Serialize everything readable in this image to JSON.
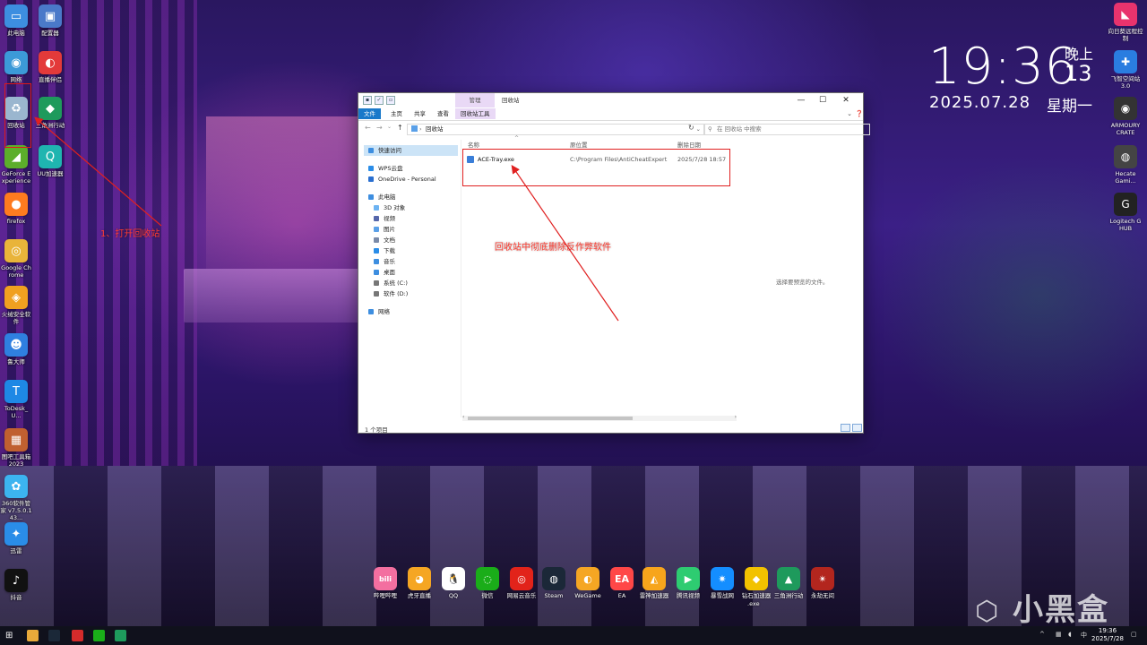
{
  "desktop_left_icons": [
    {
      "label": "此电脑",
      "color": "#3d8ee0",
      "glyph": "▭"
    },
    {
      "label": "配置器",
      "color": "#4a79c9",
      "glyph": "▣"
    },
    {
      "label": "网络",
      "color": "#3c9ad8",
      "glyph": "◉"
    },
    {
      "label": "直播伴侣",
      "color": "#e33a3a",
      "glyph": "◐"
    },
    {
      "label": "回收站",
      "color": "#9ab6cf",
      "glyph": "♻"
    },
    {
      "label": "三角洲行动",
      "color": "#1e9a5c",
      "glyph": "◆"
    },
    {
      "label": "GeForce Experience",
      "color": "#5cae2b",
      "glyph": "◢"
    },
    {
      "label": "UU加速器",
      "color": "#1fb5b0",
      "glyph": "Q"
    },
    {
      "label": "firefox",
      "color": "#ff7b1f",
      "glyph": "●"
    },
    {
      "label": "Google Chrome",
      "color": "#e9b43a",
      "glyph": "◎"
    },
    {
      "label": "火绒安全软件",
      "color": "#f0a020",
      "glyph": "◈"
    },
    {
      "label": "鲁大师",
      "color": "#2f7fe0",
      "glyph": "☻"
    },
    {
      "label": "ToDesk_U...",
      "color": "#1e88e5",
      "glyph": "T"
    },
    {
      "label": "图吧工具箱 2023",
      "color": "#c06030",
      "glyph": "▦"
    },
    {
      "label": "360软件管家 v7.5.0.143...",
      "color": "#3cb4f0",
      "glyph": "✿"
    },
    {
      "label": "迅雷",
      "color": "#2a8de8",
      "glyph": "✦"
    },
    {
      "label": "抖音",
      "color": "#111111",
      "glyph": "♪"
    }
  ],
  "annotations": {
    "step1": "1、打开回收站",
    "step2": "回收站中彻底删除反作弊软件"
  },
  "clock": {
    "time": "19:36",
    "period": "晚上",
    "day": "13",
    "date": "2025.07.28",
    "weekday": "星期一"
  },
  "explorer": {
    "context_tab": "管理",
    "title": "回收站",
    "ribbon_tabs": [
      "文件",
      "主页",
      "共享",
      "查看",
      "回收站工具"
    ],
    "address": "回收站",
    "search_placeholder": "在 回收站 中搜索",
    "nav": [
      {
        "label": "快速访问",
        "level": 0,
        "color": "#3d8ee0"
      },
      {
        "label": "WPS云盘",
        "level": 0,
        "color": "#2a8de8"
      },
      {
        "label": "OneDrive - Personal",
        "level": 0,
        "color": "#2a6fd0"
      },
      {
        "label": "此电脑",
        "level": 0,
        "color": "#3d8ee0"
      },
      {
        "label": "3D 对象",
        "level": 1,
        "color": "#6db3f2"
      },
      {
        "label": "视频",
        "level": 1,
        "color": "#5566aa"
      },
      {
        "label": "图片",
        "level": 1,
        "color": "#5aa0e8"
      },
      {
        "label": "文档",
        "level": 1,
        "color": "#7a8aa8"
      },
      {
        "label": "下载",
        "level": 1,
        "color": "#2a8de8"
      },
      {
        "label": "音乐",
        "level": 1,
        "color": "#3d8ee0"
      },
      {
        "label": "桌面",
        "level": 1,
        "color": "#3d8ee0"
      },
      {
        "label": "系统 (C:)",
        "level": 1,
        "color": "#777777"
      },
      {
        "label": "软件 (D:)",
        "level": 1,
        "color": "#777777"
      },
      {
        "label": "网络",
        "level": 0,
        "color": "#3d8ee0"
      }
    ],
    "columns": {
      "name": "名称",
      "location": "原位置",
      "date": "删除日期"
    },
    "file": {
      "name": "ACE-Tray.exe",
      "location": "C:\\Program Files\\AntiCheatExpert",
      "date": "2025/7/28 18:57"
    },
    "preview_text": "选择要预览的文件。",
    "status": "1 个项目"
  },
  "desktop_right_icons": [
    {
      "label": "向日葵远程控制",
      "color": "#e8336d",
      "glyph": "◣"
    },
    {
      "label": "飞智空间站 3.0",
      "color": "#2a7de0",
      "glyph": "✚"
    },
    {
      "label": "ARMOURY CRATE",
      "color": "#333333",
      "glyph": "◉"
    },
    {
      "label": "Hecate Gami...",
      "color": "#444444",
      "glyph": "◍"
    },
    {
      "label": "Logitech G HUB",
      "color": "#222222",
      "glyph": "G"
    }
  ],
  "dock": [
    {
      "label": "哔哩哔哩",
      "color": "#f36fa0",
      "glyph": "bili"
    },
    {
      "label": "虎牙直播",
      "color": "#f5a623",
      "glyph": "◕"
    },
    {
      "label": "QQ",
      "color": "#ffffff",
      "glyph": "🐧"
    },
    {
      "label": "微信",
      "color": "#1aad19",
      "glyph": "◌"
    },
    {
      "label": "网易云音乐",
      "color": "#e2231a",
      "glyph": "◎"
    },
    {
      "label": "Steam",
      "color": "#1b2838",
      "glyph": "◍"
    },
    {
      "label": "WeGame",
      "color": "#f5a623",
      "glyph": "◐"
    },
    {
      "label": "EA",
      "color": "#ff4747",
      "glyph": "EA"
    },
    {
      "label": "雷神加速器",
      "color": "#f7a51c",
      "glyph": "◭"
    },
    {
      "label": "腾讯视频",
      "color": "#2ecc71",
      "glyph": "▶"
    },
    {
      "label": "暴雪战网",
      "color": "#148eff",
      "glyph": "✷"
    },
    {
      "label": "钻石加速器",
      "color": "#f2c200",
      "glyph": "◆"
    },
    {
      "label": "三角洲行动",
      "color": "#1e9a5c",
      "glyph": "▲"
    },
    {
      "label": "永劫无间",
      "color": "#b3261e",
      "glyph": "✴"
    }
  ],
  "dock_extra_label": ".exe",
  "watermark": "小黑盒",
  "taskbar": {
    "tray_ime": "中",
    "time": "19:36",
    "date": "2025/7/28"
  }
}
